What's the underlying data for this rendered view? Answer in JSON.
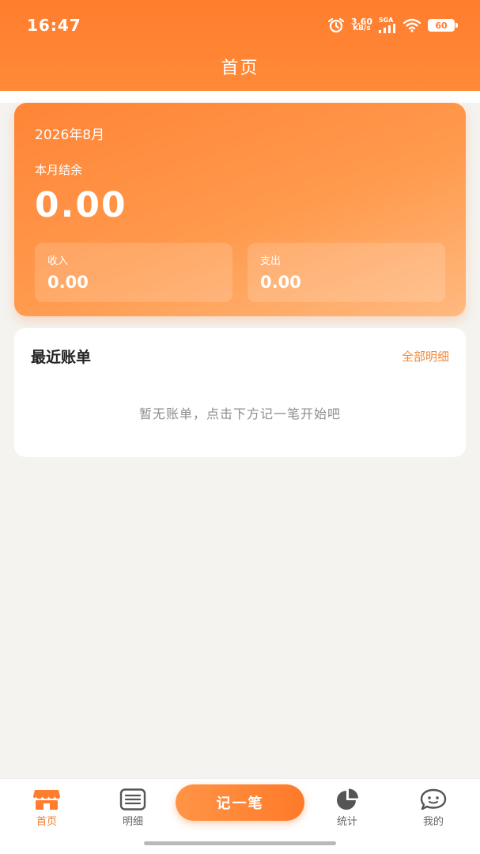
{
  "status_bar": {
    "time": "16:47",
    "speed_value": "3.60",
    "speed_unit": "KB/s",
    "network": "5GA",
    "battery": "60"
  },
  "header": {
    "title": "首页"
  },
  "balance_card": {
    "month": "2026年8月",
    "balance_label": "本月结余",
    "balance_value": "0.00",
    "income_label": "收入",
    "income_value": "0.00",
    "expense_label": "支出",
    "expense_value": "0.00"
  },
  "recent": {
    "title": "最近账单",
    "view_all": "全部明细",
    "empty_text": "暂无账单，点击下方记一笔开始吧"
  },
  "nav": {
    "items": [
      {
        "label": "首页",
        "icon": "shop-icon",
        "active": true
      },
      {
        "label": "明细",
        "icon": "list-icon",
        "active": false
      },
      {
        "label": "统计",
        "icon": "pie-chart-icon",
        "active": false
      },
      {
        "label": "我的",
        "icon": "smile-chat-icon",
        "active": false
      }
    ],
    "record_label": "记一笔"
  },
  "colors": {
    "accent": "#ff7d2e",
    "accent_text": "#f08a3c",
    "background": "#f4f3f0"
  }
}
